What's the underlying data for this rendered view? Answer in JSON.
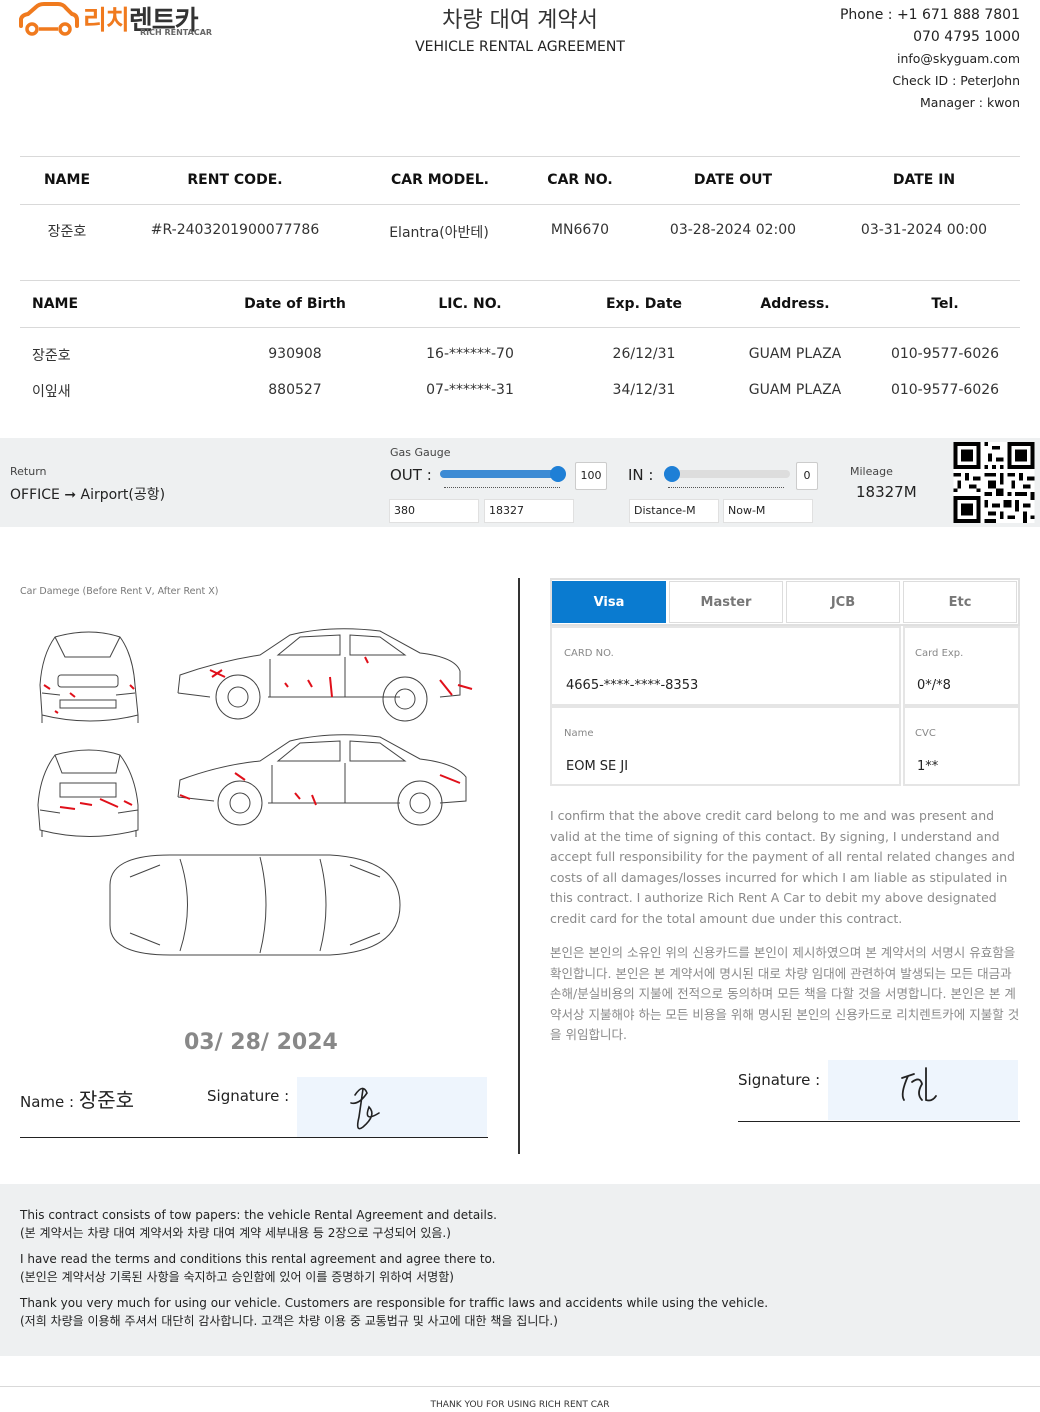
{
  "header": {
    "logo_ko_main": "리치",
    "logo_ko_rest": "렌트카",
    "logo_en": "RICH RENTACAR",
    "title_ko": "차량 대여 계약서",
    "title_en": "VEHICLE RENTAL AGREEMENT",
    "phone": "Phone : +1 671 888 7801",
    "phone2": "070 4795 1000",
    "email": "info@skyguam.com",
    "check_id": "Check ID : PeterJohn",
    "manager": "Manager : kwon"
  },
  "rental": {
    "headers": [
      "NAME",
      "RENT CODE.",
      "CAR MODEL.",
      "CAR NO.",
      "DATE OUT",
      "DATE IN"
    ],
    "row": [
      "장준호",
      "#R-2403201900077786",
      "Elantra(아반테)",
      "MN6670",
      "03-28-2024 02:00",
      "03-31-2024 00:00"
    ]
  },
  "drivers": {
    "headers": [
      "NAME",
      "Date of Birth",
      "LIC. NO.",
      "Exp. Date",
      "Address.",
      "Tel."
    ],
    "rows": [
      [
        "장준호",
        "930908",
        "16-******-70",
        "26/12/31",
        "GUAM PLAZA",
        "010-9577-6026"
      ],
      [
        "이잎새",
        "880527",
        "07-******-31",
        "34/12/31",
        "GUAM PLAZA",
        "010-9577-6026"
      ]
    ]
  },
  "return_info": {
    "label": "Return",
    "route": "OFFICE ➞ Airport(공항)",
    "gas_label": "Gas Gauge",
    "out_label": "OUT :",
    "out_value": "100",
    "out_level": 1.0,
    "in_label": "IN :",
    "in_value": "0",
    "in_level": 0.0,
    "out_distance": "380",
    "out_mileage": "18327",
    "in_distance_placeholder": "Distance-M",
    "in_mileage_placeholder": "Now-M",
    "mileage_label": "Mileage",
    "mileage_value": "18327M"
  },
  "damage": {
    "caption": "Car Damege (Before Rent V, After Rent X)",
    "date": "03/ 28/ 2024",
    "name_label": "Name :",
    "name_value": "장준호",
    "signature_label": "Signature :"
  },
  "card": {
    "tabs": [
      "Visa",
      "Master",
      "JCB",
      "Etc"
    ],
    "active_tab": "Visa",
    "card_no_label": "CARD NO.",
    "card_no": "4665-****-****-8353",
    "exp_label": "Card Exp.",
    "exp": "0*/*8",
    "name_label": "Name",
    "name": "EOM SE JI",
    "cvc_label": "CVC",
    "cvc": "1**",
    "consent_en": "I confirm that the above credit card belong to me and was present and valid at the time of signing of this contact. By signing, I understand and accept full responsibility for the payment of all rental related changes and costs of all damages/losses incurred for which I am liable as stipulated in this contract. I authorize Rich Rent A Car to debit my above designated credit card for the total amount due under this contract.",
    "consent_ko": "본인은 본인의 소유인 위의 신용카드를 본인이 제시하였으며 본 계약서의 서명시 유효함을 확인합니다. 본인은 본 계약서에 명시된 대로 차량 임대에 관련하여 발생되는 모든 대금과 손해/분실비용의 지불에 전적으로 동의하며 모든 책을 다할 것을 서명합니다. 본인은 본 계약서상 지불해야 하는 모든 비용을 위해 명시된 본인의 신용카드로 리치렌트카에 지불할 것을 위임합니다.",
    "signature_label": "Signature :"
  },
  "notice": {
    "l1": "This contract consists of tow papers: the vehicle Rental Agreement and details.",
    "l2": "(본 계약서는 차량 대여 계약서와 차량 대여 계약 세부내용 등 2장으로 구성되어 있음.)",
    "l3": "I have read the terms and conditions this rental agreement and agree there to.",
    "l4": "(본인은 계약서상 기록된 사항을 숙지하고 승인함에 있어 이를 증명하기 위하여 서명함)",
    "l5": "Thank you very much for using our vehicle. Customers are responsible for traffic laws and accidents while using the vehicle.",
    "l6": "(저희 차량을 이용해 주셔서 대단히 감사합니다. 고객은 차량 이용 중 교통법규 및 사고에 대한 책을 집니다.)"
  },
  "footer": {
    "thanks": "THANK YOU FOR USING RICH RENT CAR"
  },
  "colors": {
    "brand": "#f07a1e",
    "accent": "#0a7bd0",
    "band": "#eef0f1",
    "damage": "#e0101a"
  }
}
